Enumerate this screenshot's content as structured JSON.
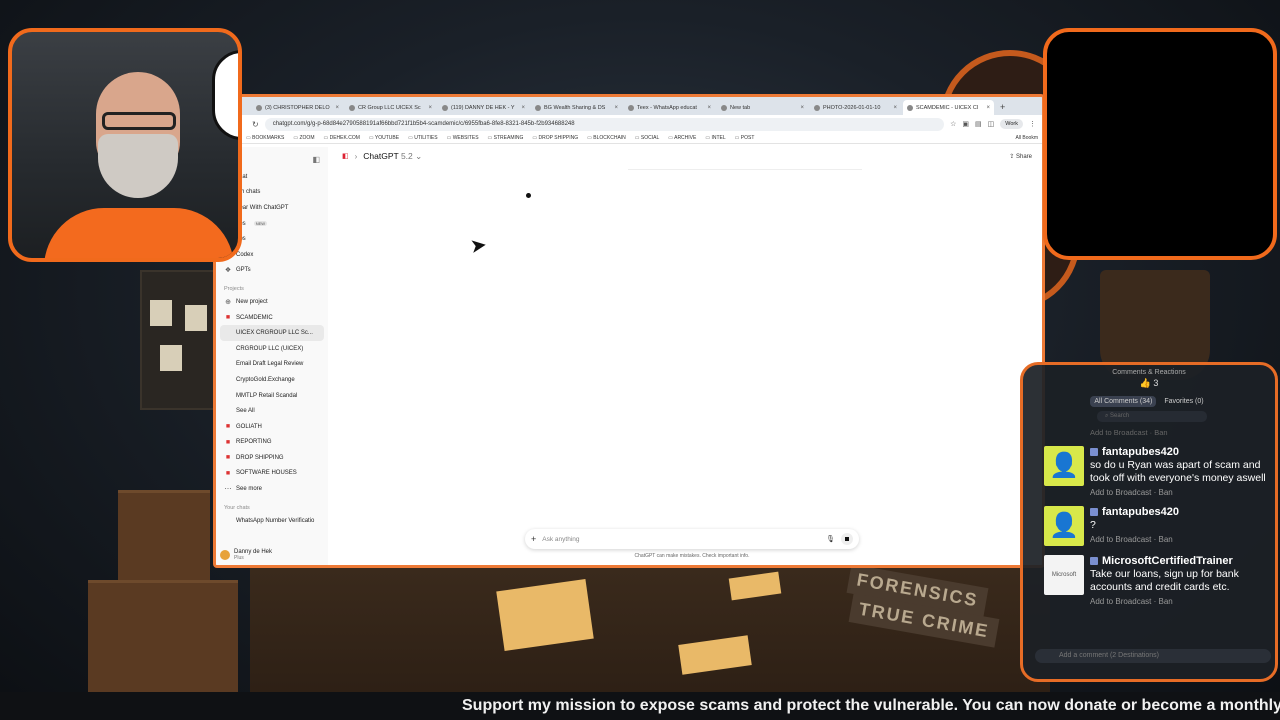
{
  "browser": {
    "tabs": [
      {
        "label": "(3) CHRISTOPHER DELO",
        "active": false
      },
      {
        "label": "CR Group LLC UICEX Sc",
        "active": false
      },
      {
        "label": "(119) DANNY DE HEK - Y",
        "active": false
      },
      {
        "label": "BG Wealth Sharing & DS",
        "active": false
      },
      {
        "label": "Teex - WhatsApp educat",
        "active": false
      },
      {
        "label": "New tab",
        "active": false
      },
      {
        "label": "PHOTO-2026-01-01-10",
        "active": false
      },
      {
        "label": "SCAMDEMIC - UICEX CI",
        "active": true
      }
    ],
    "url": "chatgpt.com/g/g-p-68d84e2790588191af66bbd721f1b5b4-scamdemic/c/6955fba6-8fe8-8321-845b-f2b934688248",
    "profile": "Work",
    "bookmarks": [
      "BOOKMARKS",
      "ZOOM",
      "DEHEK.COM",
      "YOUTUBE",
      "UTILITIES",
      "WEBSITES",
      "STREAMING",
      "DROP SHIPPING",
      "BLOCKCHAIN",
      "SOCIAL",
      "ARCHIVE",
      "INTEL",
      "POST"
    ],
    "bookmarks_right": "All Bookm"
  },
  "sidebar": {
    "items": [
      {
        "label": "chat",
        "icon": "new-chat-icon"
      },
      {
        "label": "rch chats",
        "icon": "search-icon"
      },
      {
        "label": "Year With ChatGPT",
        "icon": "sparkle-icon"
      },
      {
        "label": "ges",
        "icon": "image-icon",
        "badge": "NEW"
      },
      {
        "label": "pps",
        "icon": "apps-icon"
      },
      {
        "label": "Codex",
        "icon": "codex-icon"
      },
      {
        "label": "GPTs",
        "icon": "gpts-icon"
      }
    ],
    "projects_label": "Projects",
    "projects": [
      {
        "label": "New project",
        "icon": "folder-plus-icon",
        "active": false
      },
      {
        "label": "SCAMDEMIC",
        "icon": "project-icon",
        "active": false
      },
      {
        "label": "UICEX CRGROUP LLC Sc...",
        "icon": "",
        "active": true
      },
      {
        "label": "CRGROUP LLC (UICEX)",
        "icon": "",
        "active": false
      },
      {
        "label": "Email Draft Legal Review",
        "icon": "",
        "active": false
      },
      {
        "label": "CryptoGold.Exchange",
        "icon": "",
        "active": false
      },
      {
        "label": "MMTLP Retail Scandal",
        "icon": "",
        "active": false
      },
      {
        "label": "See All",
        "icon": "",
        "active": false
      },
      {
        "label": "GOLIATH",
        "icon": "project-icon",
        "active": false
      },
      {
        "label": "REPORTING",
        "icon": "project-icon",
        "active": false
      },
      {
        "label": "DROP SHIPPING",
        "icon": "project-icon",
        "active": false
      },
      {
        "label": "SOFTWARE HOUSES",
        "icon": "project-icon",
        "active": false
      },
      {
        "label": "See more",
        "icon": "more-icon",
        "active": false
      }
    ],
    "chats_label": "Your chats",
    "chats": [
      {
        "label": "WhatsApp Number Verificatio"
      }
    ],
    "user": {
      "name": "Danny de Hek",
      "plan": "Plus"
    }
  },
  "main": {
    "model": "ChatGPT",
    "version": "5.2",
    "share_label": "Share",
    "composer_placeholder": "Ask anything",
    "disclaimer": "ChatGPT can make mistakes. Check important info."
  },
  "comments": {
    "title": "Comments & Reactions",
    "reactions": "👍 3",
    "tab_all": "All Comments (34)",
    "tab_fav": "Favorites (0)",
    "search_placeholder": "Search",
    "faded_actions": "Add to Broadcast · Ban",
    "items": [
      {
        "name": "fantapubes420",
        "text": "so do u Ryan was apart of scam and took off with everyone's money aswell",
        "actions": "Add to Broadcast · Ban"
      },
      {
        "name": "fantapubes420",
        "text": "?",
        "actions": "Add to Broadcast · Ban"
      },
      {
        "name": "MicrosoftCertifiedTrainer",
        "text": "Take our loans, sign up for bank accounts and credit cards etc.",
        "actions": "Add to Broadcast · Ban"
      }
    ],
    "input_placeholder": "Add a comment (2 Destinations)"
  },
  "ticker": "Support my mission to expose scams and protect the vulnerable. You can now donate or become a monthly"
}
